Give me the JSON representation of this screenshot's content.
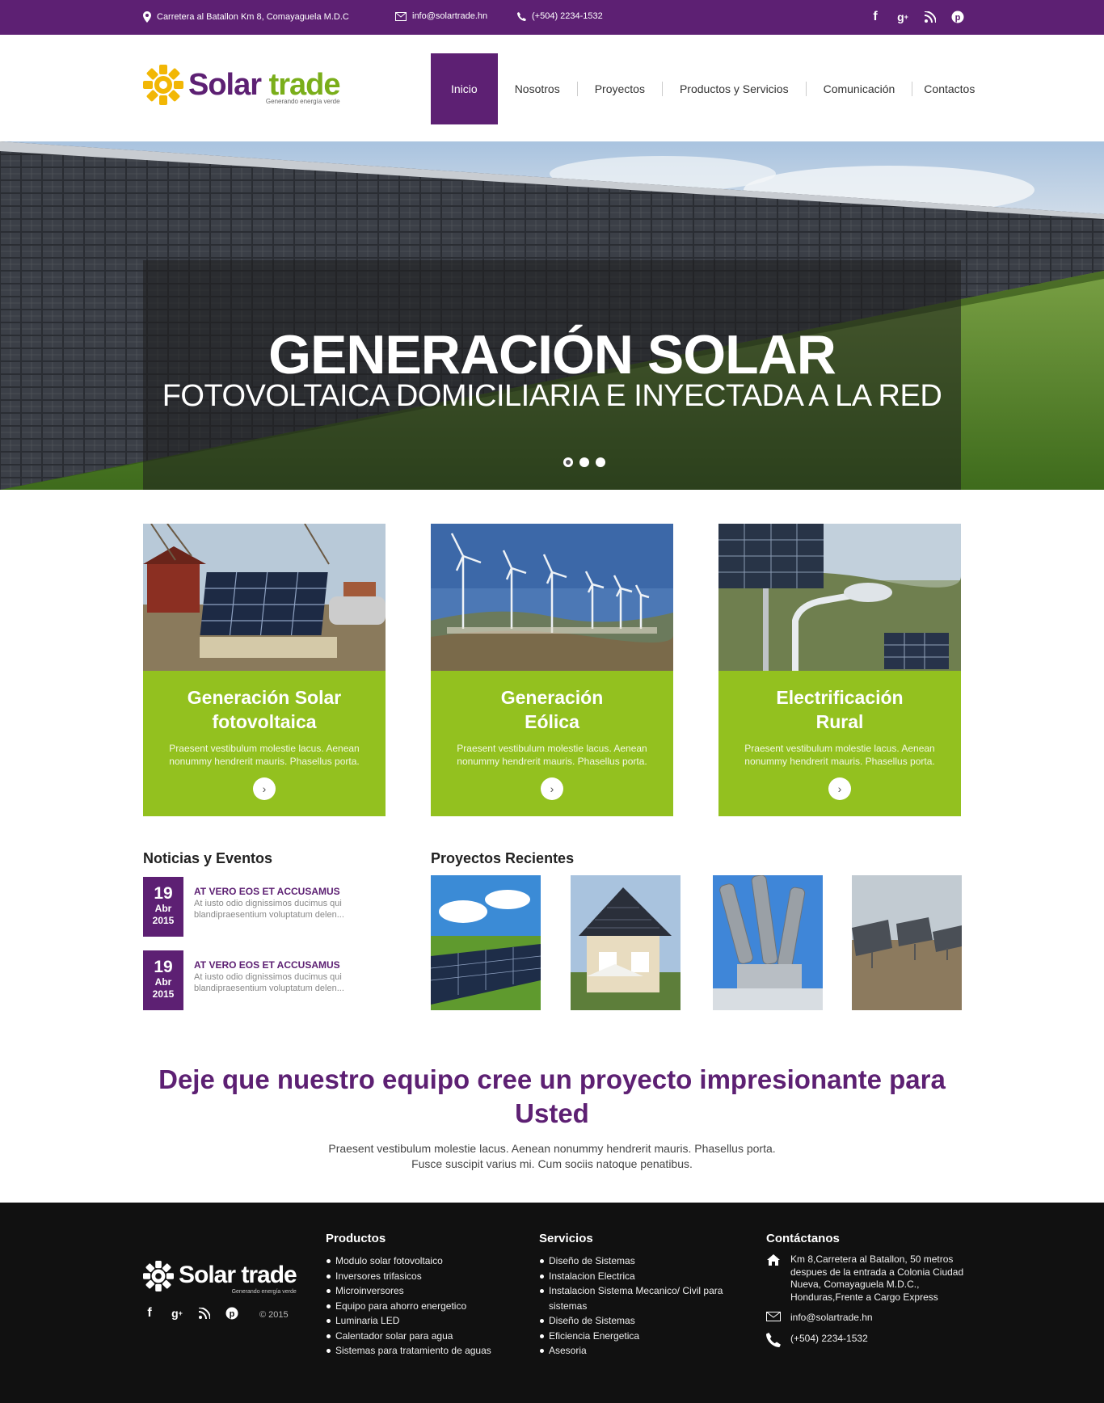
{
  "topbar": {
    "address": "Carretera al Batallon Km 8, Comayaguela M.D.C",
    "email": "info@solartrade.hn",
    "phone": "(+504) 2234-1532",
    "social_icons": [
      "facebook-icon",
      "google-plus-icon",
      "rss-icon",
      "pinterest-icon"
    ]
  },
  "brand": {
    "name_part1": "Solar",
    "name_part2": "trade",
    "tagline": "Generando energía verde",
    "colors": {
      "purple": "#5d2073",
      "green": "#93c11f",
      "logo_green": "#7aae1a",
      "sun": "#f2b705"
    }
  },
  "nav": {
    "items": [
      "Inicio",
      "Nosotros",
      "Proyectos",
      "Productos y Servicios",
      "Comunicación",
      "Contactos"
    ],
    "active": "Inicio"
  },
  "hero": {
    "title": "GENERACIÓN SOLAR",
    "subtitle": "FOTOVOLTAICA DOMICILIARIA E INYECTADA A LA RED",
    "slides": 3,
    "active_slide": 1
  },
  "cards": [
    {
      "title": "Generación Solar\nfotovoltaica",
      "text": "Praesent vestibulum molestie lacus. Aenean nonummy hendrerit mauris. Phasellus porta."
    },
    {
      "title": "Generación\nEólica",
      "text": "Praesent vestibulum molestie lacus. Aenean nonummy hendrerit mauris. Phasellus porta."
    },
    {
      "title": "Electrificación\nRural",
      "text": "Praesent vestibulum molestie lacus. Aenean nonummy hendrerit mauris. Phasellus porta."
    }
  ],
  "news": {
    "heading": "Noticias y Eventos",
    "items": [
      {
        "day": "19",
        "month": "Abr",
        "year": "2015",
        "title": "AT VERO EOS ET ACCUSAMUS",
        "text": "At iusto odio dignissimos ducimus qui blandipraesentium voluptatum delen..."
      },
      {
        "day": "19",
        "month": "Abr",
        "year": "2015",
        "title": "AT VERO EOS ET ACCUSAMUS",
        "text": "At iusto odio dignissimos ducimus qui blandipraesentium voluptatum delen..."
      }
    ]
  },
  "projects": {
    "heading": "Proyectos Recientes"
  },
  "cta": {
    "title": "Deje que nuestro equipo cree un proyecto impresionante para Usted",
    "text_line1": "Praesent vestibulum molestie lacus. Aenean nonummy hendrerit mauris. Phasellus porta.",
    "text_line2": "Fusce suscipit varius mi. Cum sociis natoque penatibus."
  },
  "footer": {
    "copyright": "© 2015",
    "productos": {
      "heading": "Productos",
      "items": [
        "Modulo solar fotovoltaico",
        "Inversores trifasicos",
        "Microinversores",
        "Equipo para ahorro energetico",
        "Luminaria LED",
        "Calentador solar para agua",
        "Sistemas para tratamiento de aguas"
      ]
    },
    "servicios": {
      "heading": "Servicios",
      "items": [
        "Diseño de Sistemas",
        "Instalacion Electrica",
        "Instalacion Sistema  Mecanico/ Civil para sistemas",
        "Diseño de Sistemas",
        "Eficiencia Energetica",
        "Asesoria"
      ]
    },
    "contacto": {
      "heading": "Contáctanos",
      "address": "Km 8,Carretera al Batallon, 50 metros despues de la entrada a Colonia Ciudad Nueva, Comayaguela M.D.C., Honduras,Frente a Cargo Express",
      "email": "info@solartrade.hn",
      "phone": "(+504) 2234-1532"
    }
  }
}
